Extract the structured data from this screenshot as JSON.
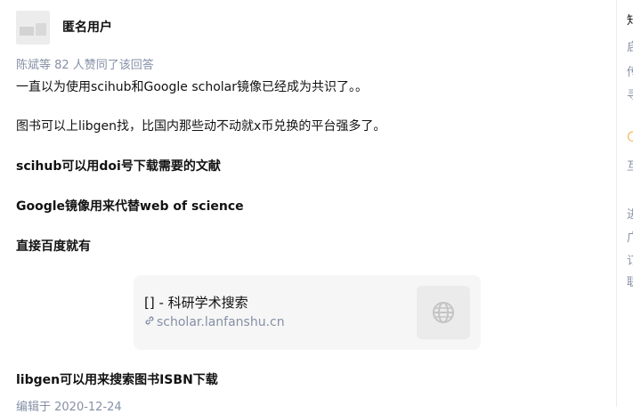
{
  "answer": {
    "author_name": "匿名用户",
    "voters_text": "陈斌等 82 人赞同了该回答",
    "paragraphs": [
      "一直以为使用scihub和Google scholar镜像已经成为共识了。。",
      "图书可以上libgen找，比国内那些动不动就x币兑换的平台强多了。",
      "scihub可以用doi号下载需要的文献",
      "Google镜像用来代替web of science",
      "直接百度就有",
      "libgen可以用来搜索图书ISBN下载"
    ],
    "link_card": {
      "title": "[] - 科研学术搜索",
      "url": "scholar.lanfanshu.cn",
      "thumb_icon": "globe-icon"
    },
    "edited_text": "编辑于 2020-12-24"
  },
  "sidebar_fragments": [
    "知",
    "启",
    "传",
    "寻",
    "🌕",
    "互",
    "",
    "",
    "",
    "",
    "进",
    "广",
    "订",
    "联"
  ]
}
